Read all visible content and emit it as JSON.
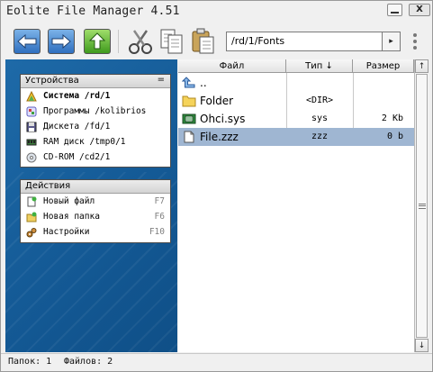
{
  "window": {
    "title": "Eolite File Manager 4.51",
    "close_label": "X"
  },
  "toolbar": {
    "path": "/rd/1/Fonts",
    "go_glyph": "▸"
  },
  "devices": {
    "header": "Устройства",
    "collapse_glyph": "=",
    "items": [
      {
        "label": "Система /rd/1",
        "icon": "system-icon",
        "active": true
      },
      {
        "label": "Программы /kolibrios",
        "icon": "programs-icon"
      },
      {
        "label": "Дискета /fd/1",
        "icon": "floppy-icon"
      },
      {
        "label": "RAM диск /tmp0/1",
        "icon": "ram-disk-icon"
      },
      {
        "label": "CD-ROM /cd2/1",
        "icon": "cdrom-icon"
      }
    ]
  },
  "actions": {
    "header": "Действия",
    "items": [
      {
        "label": "Новый файл",
        "key": "F7",
        "icon": "new-file-icon"
      },
      {
        "label": "Новая папка",
        "key": "F6",
        "icon": "new-folder-icon"
      },
      {
        "label": "Настройки",
        "key": "F10",
        "icon": "settings-icon"
      }
    ]
  },
  "filelist": {
    "columns": {
      "name": "Файл",
      "type": "Тип ↓",
      "size": "Размер"
    },
    "rows": [
      {
        "name": "..",
        "type": "",
        "size": "",
        "icon": "up-arrow-icon"
      },
      {
        "name": "Folder",
        "type": "<DIR>",
        "size": "",
        "icon": "folder-icon"
      },
      {
        "name": "Ohci.sys",
        "type": "sys",
        "size": "2 Kb",
        "icon": "driver-icon"
      },
      {
        "name": "File.zzz",
        "type": "zzz",
        "size": "0 b",
        "icon": "file-icon",
        "selected": true
      }
    ]
  },
  "scrollbar": {
    "up_glyph": "↑",
    "down_glyph": "↓"
  },
  "status": {
    "folders": "Папок: 1",
    "files": "Файлов: 2"
  },
  "colors": {
    "left_panel": "#1e6aa8",
    "selection": "#9fb6d2",
    "nav_blue": "#2f6fbf",
    "nav_green": "#3f9a1d"
  }
}
